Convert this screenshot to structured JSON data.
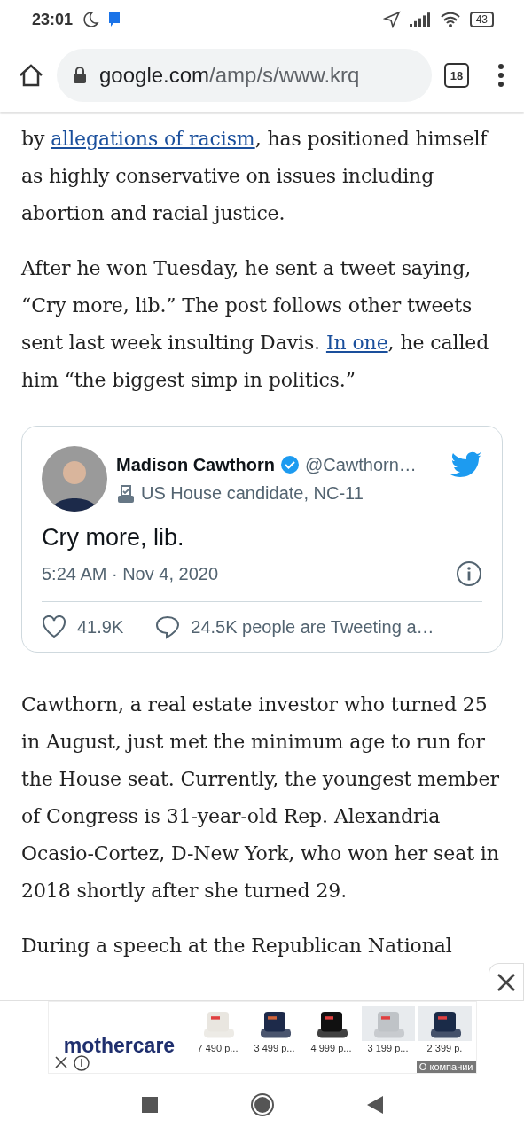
{
  "status_bar": {
    "time": "23:01",
    "battery": "43"
  },
  "browser": {
    "url_host": "google.com",
    "url_path": "/amp/s/www.krq",
    "tab_count": "18"
  },
  "article": {
    "paragraphs": [
      [
        {
          "kind": "text",
          "text": "by "
        },
        {
          "kind": "link",
          "text": "allegations of racism"
        },
        {
          "kind": "text",
          "text": ", has positioned himself as highly conservative on issues including abortion and racial justice."
        }
      ],
      [
        {
          "kind": "text",
          "text": "After he won Tuesday, he sent a tweet saying, “Cry more, lib.” The post follows other tweets sent last week insulting Davis. "
        },
        {
          "kind": "link",
          "text": "In one"
        },
        {
          "kind": "text",
          "text": ", he called him “the biggest simp in politics.”"
        }
      ]
    ],
    "tweet": {
      "name": "Madison Cawthorn",
      "verified": true,
      "handle": "@Cawthorn…",
      "label": "US House candidate, NC-11",
      "text": "Cry more, lib.",
      "timestamp": "5:24 AM · Nov 4, 2020",
      "likes": "41.9K",
      "replies": "24.5K people are Tweeting a…"
    },
    "paragraphs_after": [
      [
        {
          "kind": "text",
          "text": "Cawthorn, a real estate investor who turned 25 in August, just met the minimum age to run for the House seat. Currently, the youngest member of Congress is 31-year-old Rep. Alexandria Ocasio-Cortez, D-New York, who won her seat in 2018 shortly after she turned 29."
        }
      ],
      [
        {
          "kind": "text",
          "text": "During a speech at the Republican National"
        }
      ]
    ]
  },
  "ad": {
    "brand": "mothercare",
    "products": [
      {
        "price": "7 490 р..."
      },
      {
        "price": "3 499 р..."
      },
      {
        "price": "4 999 р..."
      },
      {
        "price": "3 199 р..."
      },
      {
        "price": "2 399 р."
      }
    ],
    "about": "О компании"
  }
}
